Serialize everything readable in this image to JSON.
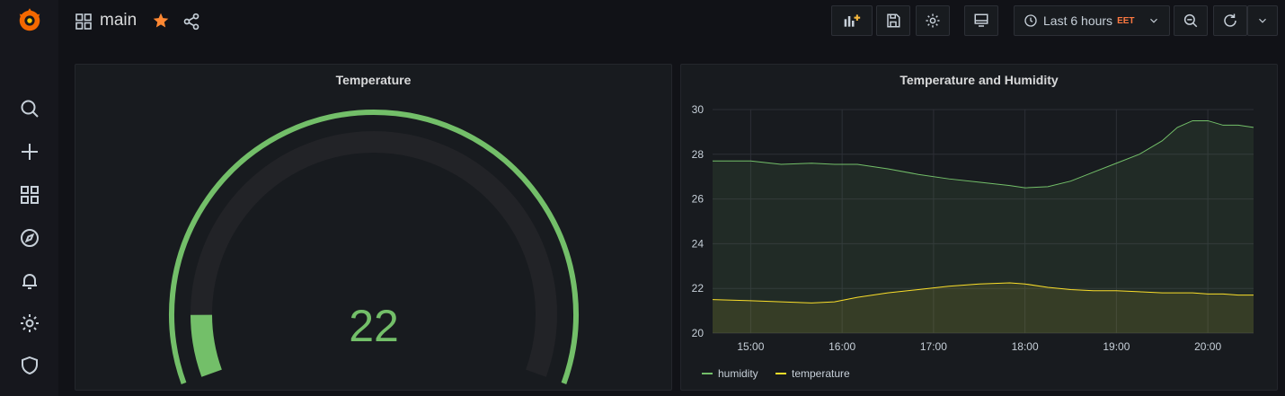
{
  "dashboard": {
    "title": "main"
  },
  "time_picker": {
    "range_label": "Last 6 hours",
    "timezone": "EET"
  },
  "sidebar": {
    "items": [
      {
        "name": "search"
      },
      {
        "name": "create"
      },
      {
        "name": "dashboards"
      },
      {
        "name": "explore"
      },
      {
        "name": "alerting"
      },
      {
        "name": "configuration"
      },
      {
        "name": "server-admin"
      }
    ]
  },
  "panels": {
    "gauge": {
      "title": "Temperature",
      "value": "22",
      "min": 0,
      "max": 100,
      "color": "#73bf69"
    },
    "timeseries": {
      "title": "Temperature and Humidity"
    }
  },
  "colors": {
    "humidity": "#73bf69",
    "temperature": "#fade2a",
    "brand": "#f46800",
    "star": "#ff8833"
  },
  "chart_data": {
    "type": "line",
    "title": "Temperature and Humidity",
    "x_ticks": [
      "15:00",
      "16:00",
      "17:00",
      "18:00",
      "19:00",
      "20:00"
    ],
    "y_ticks": [
      "20",
      "22",
      "24",
      "26",
      "28",
      "30"
    ],
    "ylim": [
      20,
      30
    ],
    "xlim": [
      "14:35",
      "20:30"
    ],
    "grid": true,
    "legend_position": "bottom-left",
    "series": [
      {
        "name": "humidity",
        "x": [
          "14:35",
          "15:00",
          "15:20",
          "15:40",
          "15:55",
          "16:10",
          "16:30",
          "16:50",
          "17:10",
          "17:30",
          "17:50",
          "18:00",
          "18:15",
          "18:30",
          "18:45",
          "19:00",
          "19:15",
          "19:30",
          "19:40",
          "19:50",
          "20:00",
          "20:10",
          "20:20",
          "20:30"
        ],
        "y": [
          27.7,
          27.7,
          27.55,
          27.6,
          27.55,
          27.55,
          27.35,
          27.1,
          26.9,
          26.75,
          26.6,
          26.5,
          26.55,
          26.8,
          27.2,
          27.6,
          28.0,
          28.6,
          29.2,
          29.5,
          29.5,
          29.3,
          29.3,
          29.2
        ]
      },
      {
        "name": "temperature",
        "x": [
          "14:35",
          "15:00",
          "15:20",
          "15:40",
          "15:55",
          "16:10",
          "16:30",
          "16:50",
          "17:10",
          "17:30",
          "17:50",
          "18:00",
          "18:15",
          "18:30",
          "18:45",
          "19:00",
          "19:15",
          "19:30",
          "19:40",
          "19:50",
          "20:00",
          "20:10",
          "20:20",
          "20:30"
        ],
        "y": [
          21.5,
          21.45,
          21.4,
          21.35,
          21.4,
          21.6,
          21.8,
          21.95,
          22.1,
          22.2,
          22.25,
          22.2,
          22.05,
          21.95,
          21.9,
          21.9,
          21.85,
          21.8,
          21.8,
          21.8,
          21.75,
          21.75,
          21.7,
          21.7
        ]
      }
    ]
  }
}
